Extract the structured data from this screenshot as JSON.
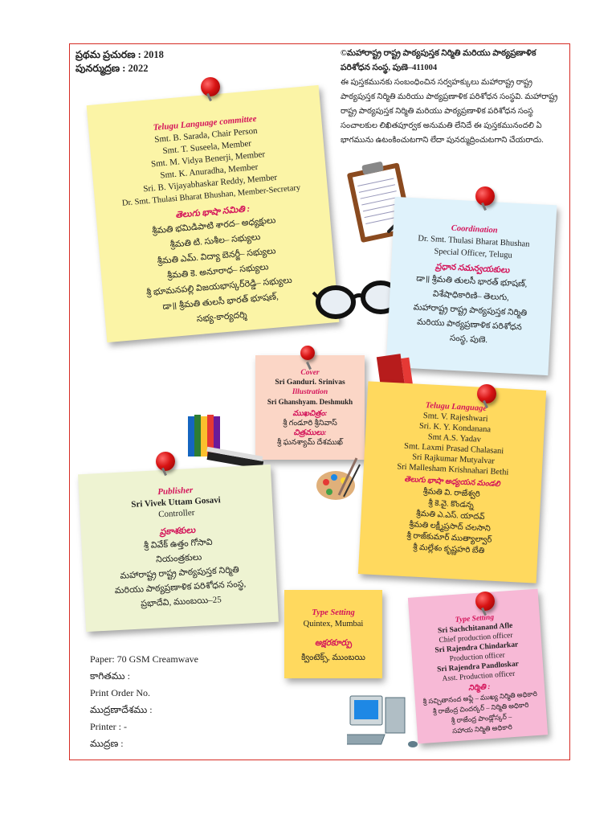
{
  "edition": {
    "first": "ప్రథమ ప్రచురణ : 2018",
    "reprint": "పునర్ముద్రణ : 2022"
  },
  "copyright": {
    "title": "©మహారాష్ట్ర రాష్ట్ర పాఠ్యపుస్తక నిర్మితి మరియు పాఠ్యప్రణాళిక పరిశోధన సంస్థ, పుణె–411004",
    "lines": [
      "ఈ పుస్తకమునకు సంబంధించిన సర్వహక్కులు మహారాష్ట్ర రాష్ట్ర",
      "పాఠ్యపుస్తక నిర్మితి మరియు పాఠ్యప్రణాళిక పరిశోధన సంస్థవి. మహారాష్ట్ర",
      "రాష్ట్ర పాఠ్యపుస్తక నిర్మితి మరియు పాఠ్యప్రణాళిక పరిశోధన సంస్థ",
      "సంచాలకుల లిఖితపూర్వక అనుమతి లేనిదే ఈ పుస్తకమునందలి ఏ",
      "భాగమును ఉటంకించుటగాని లేదా పునర్ముద్రించుటగాని చేయరాదు."
    ]
  },
  "committee": {
    "heading": "Telugu Language committee",
    "members": [
      "Smt. B. Sarada, Chair Person",
      "Smt. T. Suseela, Member",
      "Smt. M. Vidya Benerji, Member",
      "Smt. K. Anuradha, Member",
      "Sri. B. Vijayabhaskar Reddy, Member",
      "Dr. Smt. Thulasi Bharat Bhushan, Member-Secretary"
    ],
    "tel_heading": "తెలుగు భాషా సమితి :",
    "tel_members": [
      "శ్రీమతి భమిడిపాటి శారద– అధ్యక్షులు",
      "శ్రీమతి టి. సుశీల– సభ్యులు",
      "శ్రీమతి ఎమ్. విద్యా బెనర్జీ– సభ్యులు",
      "శ్రీమతి కె. అనూరాధ– సభ్యులు",
      "శ్రీ భూమనపల్లి విజయభాస్కర్‌రెడ్డి– సభ్యులు",
      "డా॥ శ్రీమతి తులసీ భారత్ భూషణ్,",
      "సభ్య-కార్యదర్శి"
    ]
  },
  "coordination": {
    "heading": "Coordination",
    "lines": [
      "Dr. Smt. Thulasi Bharat Bhushan",
      "Special Officer, Telugu"
    ],
    "tel_heading": "ప్రధాన సమన్వయకులు",
    "tel_lines": [
      "డా॥ శ్రీమతి తులసీ భారత్ భూషణ్,",
      "విశేషాధికారిణి– తెలుగు,",
      "మహారాష్ట్ర రాష్ట్ర పాఠ్యపుస్తక నిర్మితి",
      "మరియు పాఠ్యప్రణాళిక పరిశోధన",
      "సంస్థ, పుణె."
    ]
  },
  "cover": {
    "heading": "Cover",
    "name": "Sri Ganduri. Srinivas",
    "ill_heading": "Illustration",
    "ill_name": "Sri Ghanshyam. Deshmukh",
    "tel_cover_heading": "ముఖచిత్రం:",
    "tel_cover_name": "శ్రీ గండూరి శ్రీనివాస్",
    "tel_ill_heading": "చిత్రములు:",
    "tel_ill_name": "శ్రీ ఘనశ్యామ్ దేశముఖ్"
  },
  "telugu_language": {
    "heading": "Telugu Language",
    "members": [
      "Smt. V. Rajeshwari",
      "Sri. K. Y. Kondanana",
      "Smt A.S. Yadav",
      "Smt. Laxmi Prasad Chalasani",
      "Sri Rajkumar Mutyalvar",
      "Sri Mallesham Krishnahari Bethi"
    ],
    "tel_heading": "తెలుగు భాషా అధ్యయన మండలి",
    "tel_members": [
      "శ్రీమతి వి. రాజేశ్వరి",
      "శ్రీ కె.వై. కొండన్న",
      "శ్రీమతి ఎ.ఎస్. యాదవ్",
      "శ్రీమతి లక్ష్మీప్రసాద్ చలసాని",
      "శ్రీ రాజ్‌కుమార్ ముత్యాల్వార్",
      "శ్రీ మల్లేశం కృష్ణహరి బేతి"
    ]
  },
  "publisher": {
    "heading": "Publisher",
    "name": "Sri Vivek Uttam Gosavi",
    "role": "Controller",
    "tel_heading": "ప్రకాశకులు",
    "tel_name": "శ్రీ వివేక్ ఉత్తం గోసావి",
    "tel_role": "నియంత్రకులు",
    "tel_lines": [
      "మహారాష్ట్ర రాష్ట్ర పాఠ్యపుస్తక నిర్మితి",
      "మరియు పాఠ్యప్రణాళిక పరిశోధన సంస్థ,",
      "ప్రభాదేవి, ముంబయి–25"
    ]
  },
  "typesetting": {
    "heading": "Type Setting",
    "name": "Quintex, Mumbai",
    "tel_heading": "అక్షరకూర్పు",
    "tel_name": "క్వింటెక్స్, ముంబయి"
  },
  "production": {
    "heading": "Type Setting",
    "lines": [
      "Sri Sachchitanand Afle",
      "Chief production officer",
      "Sri Rajendra Chindarkar",
      "Production officer",
      "Sri Rajendra Pandloskar",
      "Asst. Production officer"
    ],
    "tel_heading": "నిర్మితి :",
    "tel_lines": [
      "శ్రీ సచ్చితానంద అఫ్లే – ముఖ్య నిర్మితి అధికారి",
      "శ్రీ రాజేంద్ర చిందర్కర్ – నిర్మితి అధికారి",
      "శ్రీ రాజేంద్ర పాండ్లోస్కర్ –",
      "సహాయ నిర్మితి అధికారి"
    ]
  },
  "print_info": {
    "paper": "Paper: 70 GSM Creamwave",
    "paper_tel": "కాగితము :",
    "order": "Print Order No.",
    "order_tel": "ముద్రణాదేశము :",
    "printer": "Printer : -",
    "printer_tel": "ముద్రణ :"
  },
  "colors": {
    "border": "#d62b24",
    "heading": "#d4145a",
    "note_yellow": "#fbf4a6",
    "note_blue": "#dff2fb",
    "note_peach": "#fbd6c6",
    "note_orange": "#ffd95e",
    "note_green": "#eef3d2",
    "note_pink": "#f7b9d6"
  }
}
